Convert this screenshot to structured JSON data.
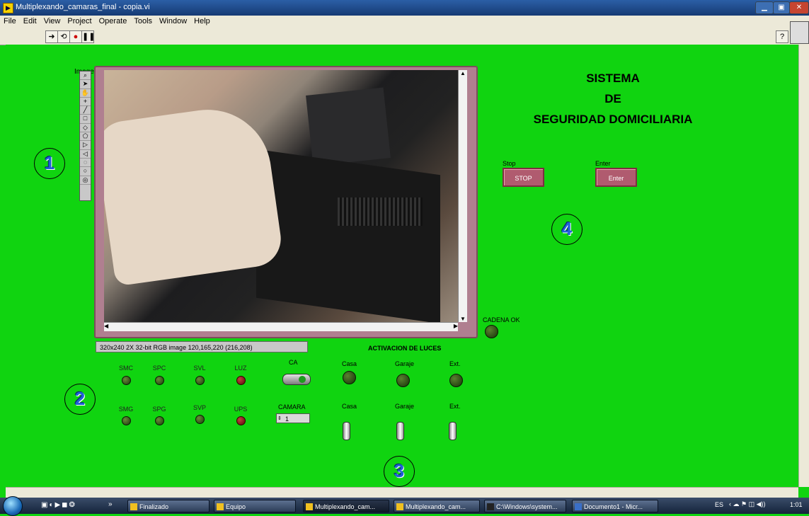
{
  "window": {
    "title": "Multiplexando_camaras_final - copia.vi",
    "controls": [
      "minimize",
      "maximize",
      "close"
    ]
  },
  "menu": [
    "File",
    "Edit",
    "View",
    "Project",
    "Operate",
    "Tools",
    "Window",
    "Help"
  ],
  "toolbar": {
    "buttons": [
      "run-arrow-icon",
      "run-continuously-icon",
      "abort-icon",
      "pause-icon"
    ],
    "help_label": "?"
  },
  "image_display": {
    "label": "Image",
    "status": "320x240 2X 32-bit RGB image 120,165,220    (216,208)",
    "tools": [
      "zoom-icon",
      "pointer-icon",
      "pan-icon",
      "point-icon",
      "line-icon",
      "rectangle-icon",
      "rotated-rect-icon",
      "oval-icon",
      "polygon-icon",
      "freehand-icon",
      "annulus-icon",
      "polyline-icon",
      "broken-line-icon"
    ]
  },
  "heading": {
    "line1": "SISTEMA",
    "line2": "DE",
    "line3": "SEGURIDAD DOMICILIARIA"
  },
  "buttons": {
    "stop_label": "Stop",
    "stop_text": "STOP",
    "enter_label": "Enter",
    "enter_text": "Enter"
  },
  "markers": [
    "1",
    "2",
    "3",
    "4"
  ],
  "cadena": {
    "label": "CADENA OK"
  },
  "indicators_row1": [
    {
      "label": "SMC",
      "state": "off"
    },
    {
      "label": "SPC",
      "state": "off"
    },
    {
      "label": "SVL",
      "state": "off"
    },
    {
      "label": "LUZ",
      "state": "red"
    }
  ],
  "indicators_row2": [
    {
      "label": "SMG",
      "state": "off"
    },
    {
      "label": "SPG",
      "state": "off"
    },
    {
      "label": "SVP",
      "state": "off"
    },
    {
      "label": "UPS",
      "state": "red"
    }
  ],
  "ca": {
    "label": "CA"
  },
  "camara": {
    "label": "CAMARA",
    "value": "1"
  },
  "luces": {
    "title": "ACTIVACION DE LUCES",
    "row1": [
      "Casa",
      "Garaje",
      "Ext."
    ],
    "row2": [
      "Casa",
      "Garaje",
      "Ext."
    ]
  },
  "taskbar": {
    "items": [
      "Finalizado",
      "Equipo",
      "Multiplexando_cam...",
      "Multiplexando_cam...",
      "C:\\Windows\\system...",
      "Documento1 - Micr..."
    ],
    "lang": "ES",
    "time": "1:01"
  }
}
